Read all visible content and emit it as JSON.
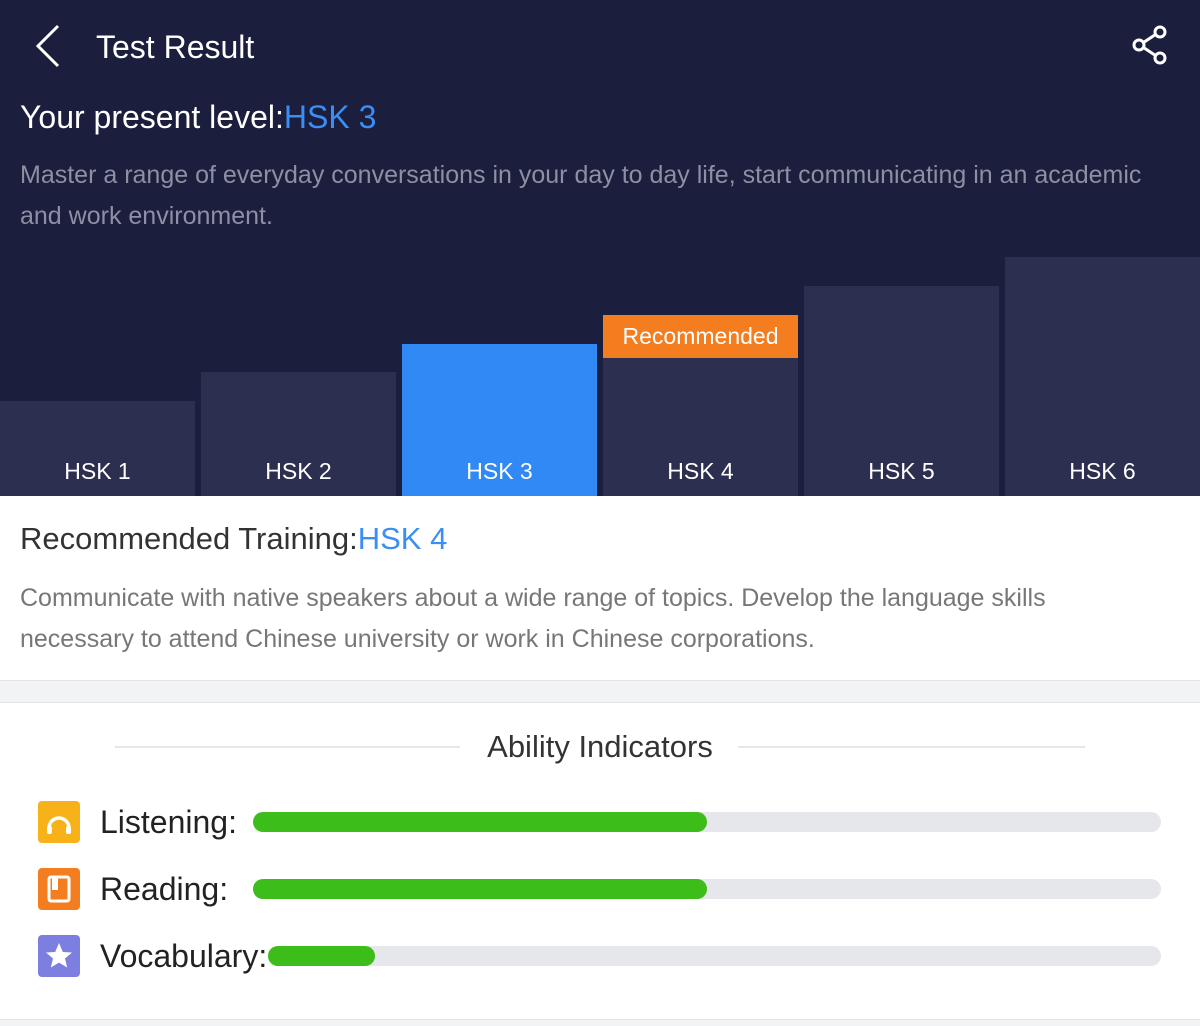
{
  "header": {
    "title": "Test Result",
    "back_icon": "chevron-left-icon",
    "share_icon": "share-icon"
  },
  "present": {
    "label": "Your present level:",
    "level": "HSK 3",
    "description": "Master a range of everyday conversations in your day to day life, start communicating in an academic and work environment."
  },
  "levels": [
    {
      "label": "HSK 1",
      "state": "normal"
    },
    {
      "label": "HSK 2",
      "state": "normal"
    },
    {
      "label": "HSK 3",
      "state": "current"
    },
    {
      "label": "HSK 4",
      "state": "recommended"
    },
    {
      "label": "HSK 5",
      "state": "normal"
    },
    {
      "label": "HSK 6",
      "state": "normal"
    }
  ],
  "recommended_badge": "Recommended",
  "recommended": {
    "label": "Recommended Training:",
    "level": "HSK 4",
    "description": "Communicate with native speakers about a wide range of topics. Develop the language skills necessary to attend Chinese university or work in Chinese corporations."
  },
  "ability": {
    "title": "Ability Indicators",
    "indicators": [
      {
        "label": "Listening:",
        "icon": "headphones-icon",
        "color": "#f7b21a",
        "value": 0.5
      },
      {
        "label": "Reading:",
        "icon": "book-icon",
        "color": "#f47d1f",
        "value": 0.5
      },
      {
        "label": "Vocabulary:",
        "icon": "star-icon",
        "color": "#7c7fe0",
        "value": 0.12
      }
    ]
  },
  "colors": {
    "header_bg": "#1b1e3d",
    "bar": "#2c2f4f",
    "current": "#3089f5",
    "recommended": "#f47d1f",
    "accent_text": "#3a8ef4",
    "progress": "#3dbd1a"
  }
}
